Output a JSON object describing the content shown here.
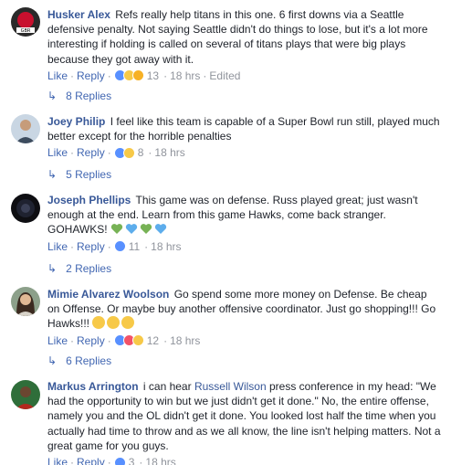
{
  "colors": {
    "author": "#385898",
    "link": "#4267b2",
    "meta": "#90949c",
    "text": "#1d2129"
  },
  "comments": [
    {
      "author": "Husker Alex",
      "text": "Refs really help titans in this one. 6 first downs via a Seattle defensive penalty. Not saying Seattle didn't do things to lose, but it's a lot more interesting if holding is called on several of titans plays that were big plays because they got away with it.",
      "like": "Like",
      "reply": "Reply",
      "reaction_count": "13",
      "time": "18 hrs",
      "edited": "Edited",
      "replies_label": "8 Replies"
    },
    {
      "author": "Joey Philip",
      "text": "I feel like this team is capable of a Super Bowl run still, played much better except for the horrible penalties",
      "like": "Like",
      "reply": "Reply",
      "reaction_count": "8",
      "time": "18 hrs",
      "replies_label": "5 Replies"
    },
    {
      "author": "Joseph Phellips",
      "text": "This game was on defense. Russ played great; just wasn't enough at the end. Learn from this game Hawks, come back stranger. GOHAWKS!",
      "like": "Like",
      "reply": "Reply",
      "reaction_count": "11",
      "time": "18 hrs",
      "replies_label": "2 Replies"
    },
    {
      "author": "Mimie Alvarez Woolson",
      "text": "Go spend some more money on Defense. Be cheap on Offense. Or maybe buy another offensive coordinator. Just go shopping!!! Go Hawks!!!",
      "like": "Like",
      "reply": "Reply",
      "reaction_count": "12",
      "time": "18 hrs",
      "replies_label": "6 Replies"
    },
    {
      "author": "Markus Arrington",
      "text_pre": "i can hear",
      "mention": "Russell Wilson",
      "text_post": "press conference in my head: \"We had the opportunity to win but we just didn't get it done.\" No, the entire offense, namely you and the OL didn't get it done. You looked lost half the time when you actually had time to throw and as we all know, the line isn't helping matters. Not a great game for you guys.",
      "like": "Like",
      "reply": "Reply",
      "reaction_count": "3",
      "time": "18 hrs"
    }
  ]
}
